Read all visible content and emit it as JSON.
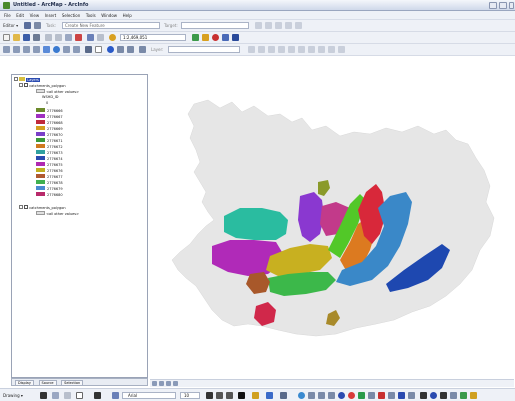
{
  "window": {
    "title": "Untitled - ArcMap - ArcInfo"
  },
  "menu": [
    "File",
    "Edit",
    "View",
    "Insert",
    "Selection",
    "Tools",
    "Window",
    "Help"
  ],
  "toolbar": {
    "editor_label": "Editor ▾",
    "scale": "1:2,469,051",
    "task_placeholder": "Create New Feature",
    "target_label": "Target:",
    "layer_label": "Layer:"
  },
  "toc": {
    "root": "Layers",
    "layer1": {
      "name": "catchments_polygon",
      "other_values": "<all other values>",
      "field": "WSHD_ID",
      "zero": "0",
      "classes": [
        {
          "label": "2776666",
          "color": "#6c8a2a"
        },
        {
          "label": "2776667",
          "color": "#a030c0"
        },
        {
          "label": "2776668",
          "color": "#c02a3c"
        },
        {
          "label": "2776669",
          "color": "#d4a020"
        },
        {
          "label": "2776670",
          "color": "#7a40c8"
        },
        {
          "label": "2776671",
          "color": "#3a9a3a"
        },
        {
          "label": "2776672",
          "color": "#d07a20"
        },
        {
          "label": "2776673",
          "color": "#30a0a0"
        },
        {
          "label": "2776674",
          "color": "#2a4ab0"
        },
        {
          "label": "2776675",
          "color": "#b02ab0"
        },
        {
          "label": "2776676",
          "color": "#c0b020"
        },
        {
          "label": "2776677",
          "color": "#b05a30"
        },
        {
          "label": "2776678",
          "color": "#40b050"
        },
        {
          "label": "2776679",
          "color": "#4a8ad0"
        },
        {
          "label": "2776680",
          "color": "#b82a6a"
        }
      ]
    },
    "layer2": {
      "name": "catchments_polygon",
      "other_values": "<all other values>"
    },
    "tabs": [
      "Display",
      "Source",
      "Selection"
    ]
  },
  "drawing": {
    "label": "Drawing ▾",
    "font": "Arial",
    "font_size": "10"
  },
  "colors": {
    "land": "#e6e6e6",
    "c_olive": "#8a9a2a",
    "c_teal": "#2abca0",
    "c_magenta": "#b02ab8",
    "c_purple": "#8a38d0",
    "c_pink": "#c23a8a",
    "c_yellow": "#c8b020",
    "c_lime": "#52c828",
    "c_orange": "#dc7a20",
    "c_red": "#d8283a",
    "c_blue": "#3a88c8",
    "c_navy": "#1e48b0",
    "c_brown": "#a8582a",
    "c_green": "#3cb84a",
    "c_crimson": "#d0284a",
    "c_gold": "#a88a2a"
  }
}
